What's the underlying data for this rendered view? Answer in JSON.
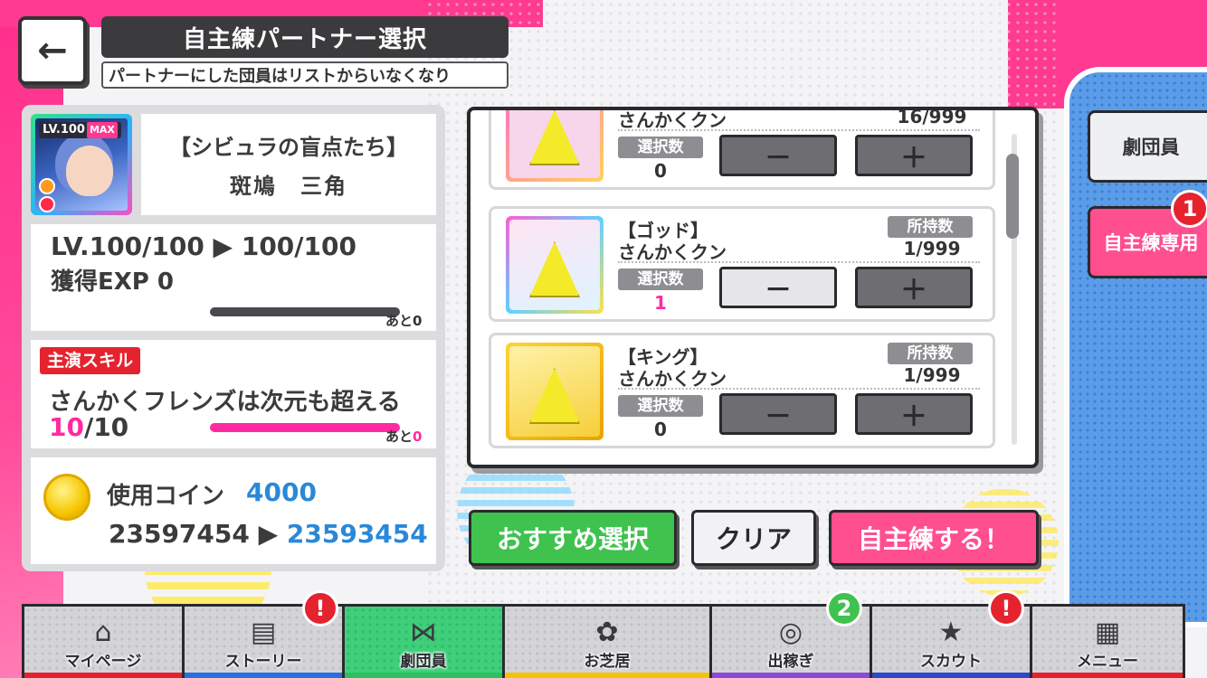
{
  "header": {
    "back_icon": "←",
    "title": "自主練パートナー選択",
    "subtitle": "パートナーにした団員はリストからいなくなり"
  },
  "character": {
    "level_badge": "LV.100",
    "max_badge": "MAX",
    "title": "【シビュラの盲点たち】",
    "name": "斑鳩　三角"
  },
  "level": {
    "line": "LV.100/100 ▶ 100/100",
    "exp": "獲得EXP 0",
    "exp_progress": 1.0,
    "remain_text": "あと0"
  },
  "skill": {
    "tag": "主演スキル",
    "name": "さんかくフレンズは次元も超える",
    "level_current": "10",
    "level_max": "/10",
    "progress": 1.0,
    "remain_prefix": "あと",
    "remain_value": "0"
  },
  "coin": {
    "label": "使用コイン",
    "cost": "4000",
    "before": "23597454",
    "arrow": " ▶ ",
    "after": "23593454"
  },
  "list": {
    "owned_label": "所持数",
    "select_label": "選択数",
    "minus": "－",
    "plus": "＋",
    "items": [
      {
        "name1": "",
        "name2": "さんかくクン",
        "owned": "16/999",
        "selected": "0"
      },
      {
        "name1": "【ゴッド】",
        "name2": "さんかくクン",
        "owned": "1/999",
        "selected": "1"
      },
      {
        "name1": "【キング】",
        "name2": "さんかくクン",
        "owned": "1/999",
        "selected": "0"
      }
    ]
  },
  "actions": {
    "recommend": "おすすめ選択",
    "clear": "クリア",
    "train": "自主練する！"
  },
  "tabs": {
    "members": "劇団員",
    "training": "自主練専用",
    "training_badge": "1"
  },
  "nav": {
    "items": [
      {
        "label": "マイページ",
        "icon": "⌂",
        "bar": "#e4232e"
      },
      {
        "label": "ストーリー",
        "icon": "▤",
        "bar": "#2a6fe0",
        "alert": "!"
      },
      {
        "label": "劇団員",
        "icon": "⋈",
        "bar": "#2ac060"
      },
      {
        "label": "お芝居",
        "icon": "✿",
        "bar": "#f4c400"
      },
      {
        "label": "出稼ぎ",
        "icon": "◎",
        "bar": "#8a4ad8",
        "count": "2"
      },
      {
        "label": "スカウト",
        "icon": "★",
        "bar": "#2a4ac8",
        "alert": "!"
      },
      {
        "label": "メニュー",
        "icon": "▦",
        "bar": "#e4232e"
      }
    ]
  }
}
